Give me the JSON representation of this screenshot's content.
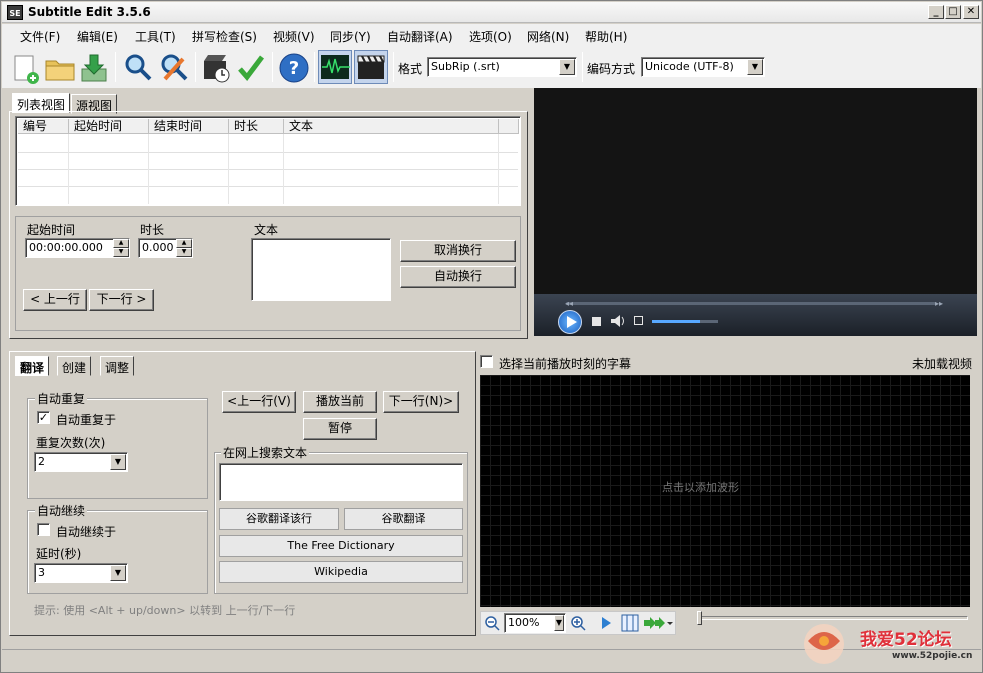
{
  "window": {
    "title": "Subtitle Edit 3.5.6",
    "app_icon": "SE"
  },
  "caption_buttons": {
    "minimize": "_",
    "maximize": "□",
    "close": "✕"
  },
  "menu": [
    "文件(F)",
    "编辑(E)",
    "工具(T)",
    "拼写检查(S)",
    "视频(V)",
    "同步(Y)",
    "自动翻译(A)",
    "选项(O)",
    "网络(N)",
    "帮助(H)"
  ],
  "toolbar": {
    "format_label": "格式",
    "format_value": "SubRip (.srt)",
    "encoding_label": "编码方式",
    "encoding_value": "Unicode (UTF-8)"
  },
  "top_tabs": {
    "list_view": "列表视图",
    "source_view": "源视图"
  },
  "list": {
    "columns": [
      "编号",
      "起始时间",
      "结束时间",
      "时长",
      "文本"
    ]
  },
  "edit": {
    "start_label": "起始时间",
    "start_value": "00:00:00.000",
    "duration_label": "时长",
    "duration_value": "0.000",
    "text_label": "文本",
    "unbreak_button": "取消换行",
    "autobreak_button": "自动换行",
    "prev_button": "< 上一行",
    "next_button": "下一行 >"
  },
  "bottom_tabs": {
    "translate": "翻译",
    "create": "创建",
    "adjust": "调整"
  },
  "autorepeat": {
    "group_title": "自动重复",
    "checkbox_label": "自动重复于",
    "checked": true,
    "count_label": "重复次数(次)",
    "count_value": "2"
  },
  "autocontinue": {
    "group_title": "自动继续",
    "checkbox_label": "自动继续于",
    "checked": false,
    "delay_label": "延时(秒)",
    "delay_value": "3"
  },
  "nav": {
    "prev": "<上一行(V)",
    "play_current": "播放当前",
    "next": "下一行(N)>",
    "pause": "暂停"
  },
  "search": {
    "group_title": "在网上搜索文本",
    "google_translate_line": "谷歌翻译该行",
    "google_translate": "谷歌翻译",
    "free_dictionary": "The Free Dictionary",
    "wikipedia": "Wikipedia"
  },
  "tip": "提示: 使用 <Alt + up/down> 以转到 上一行/下一行",
  "waveform": {
    "select_current_label": "选择当前播放时刻的字幕",
    "no_video": "未加载视频",
    "click_to_add": "点击以添加波形",
    "zoom": "100%"
  },
  "watermark": {
    "text": "我爱52论坛",
    "url": "www.52pojie.cn"
  },
  "colors": {
    "chrome": "#d4d0c8",
    "video_bg": "#141414",
    "wave_bg": "#000000",
    "accent": "#2d7fd1"
  }
}
